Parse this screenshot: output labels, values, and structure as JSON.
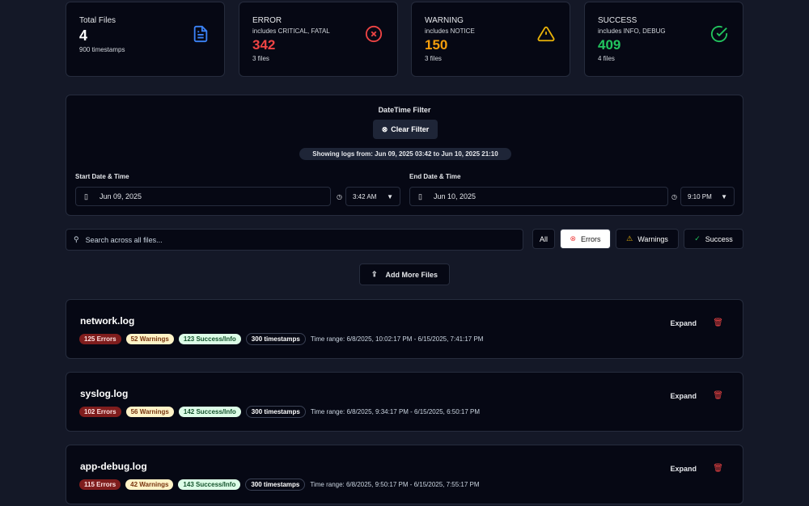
{
  "stats": [
    {
      "title": "Total Files",
      "value": "4",
      "footer": "900 timestamps",
      "icon": "file-text-icon",
      "color": "#ffffff"
    },
    {
      "title": "ERROR",
      "subtitle": "includes CRITICAL, FATAL",
      "value": "342",
      "footer": "3 files",
      "icon": "x-circle-icon",
      "color": "#ef4444"
    },
    {
      "title": "WARNING",
      "subtitle": "includes NOTICE",
      "value": "150",
      "footer": "3 files",
      "icon": "alert-triangle-icon",
      "color": "#f59e0b"
    },
    {
      "title": "SUCCESS",
      "subtitle": "includes INFO, DEBUG",
      "value": "409",
      "footer": "4 files",
      "icon": "check-circle-icon",
      "color": "#22c55e"
    }
  ],
  "filter": {
    "title": "DateTime Filter",
    "clear_label": "Clear Filter",
    "showing": "Showing logs from: Jun 09, 2025 03:42 to Jun 10, 2025 21:10",
    "start_label": "Start Date & Time",
    "start_date": "Jun 09, 2025",
    "start_time": "3:42 AM",
    "end_label": "End Date & Time",
    "end_date": "Jun 10, 2025",
    "end_time": "9:10 PM"
  },
  "search": {
    "placeholder": "Search across all files..."
  },
  "filters": {
    "all": "All",
    "errors": "Errors",
    "warnings": "Warnings",
    "success": "Success",
    "active": "Errors"
  },
  "add_label": "Add More Files",
  "files": [
    {
      "name": "network.log",
      "errors": "125 Errors",
      "warnings": "52 Warnings",
      "success": "123 Success/Info",
      "timestamps": "300 timestamps",
      "range": "Time range: 6/8/2025, 10:02:17 PM - 6/15/2025, 7:41:17 PM",
      "expand": "Expand"
    },
    {
      "name": "syslog.log",
      "errors": "102 Errors",
      "warnings": "56 Warnings",
      "success": "142 Success/Info",
      "timestamps": "300 timestamps",
      "range": "Time range: 6/8/2025, 9:34:17 PM - 6/15/2025, 6:50:17 PM",
      "expand": "Expand"
    },
    {
      "name": "app-debug.log",
      "errors": "115 Errors",
      "warnings": "42 Warnings",
      "success": "143 Success/Info",
      "timestamps": "300 timestamps",
      "range": "Time range: 6/8/2025, 9:50:17 PM - 6/15/2025, 7:55:17 PM",
      "expand": "Expand"
    }
  ]
}
